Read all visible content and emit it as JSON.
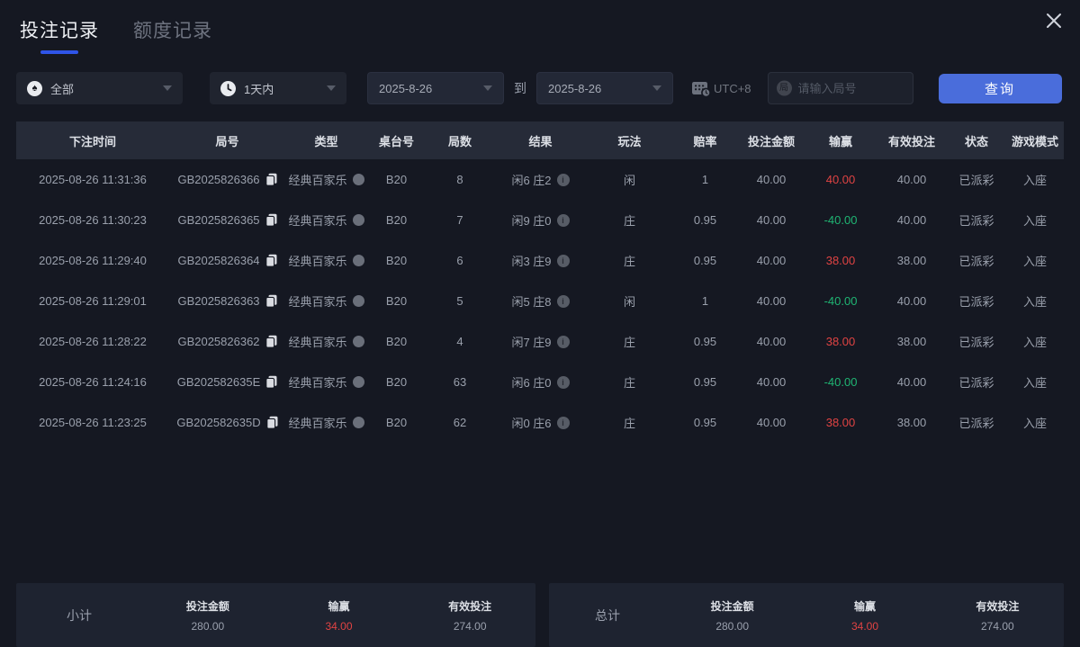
{
  "tabs": [
    {
      "label": "投注记录"
    },
    {
      "label": "额度记录"
    }
  ],
  "filters": {
    "game_type": {
      "value": "全部",
      "icon": "spade"
    },
    "time_range": {
      "value": "1天内",
      "icon": "clock"
    },
    "date_from": "2025-8-26",
    "to_label": "到",
    "date_to": "2025-8-26",
    "timezone": "UTC+8",
    "round_search": {
      "placeholder": "请输入局号",
      "icon_char": "局"
    },
    "query_label": "查询"
  },
  "table": {
    "columns": [
      "下注时间",
      "局号",
      "类型",
      "桌台号",
      "局数",
      "结果",
      "玩法",
      "赔率",
      "投注金额",
      "输赢",
      "有效投注",
      "状态",
      "游戏模式"
    ],
    "rows": [
      {
        "time": "2025-08-26 11:31:36",
        "round_id": "GB2025826366",
        "game": "经典百家乐",
        "table_no": "B20",
        "shoe": "8",
        "result": "闲6 庄2",
        "play": "闲",
        "odds": "1",
        "bet": "40.00",
        "win_loss": "40.00",
        "win_loss_type": "win",
        "valid_bet": "40.00",
        "status": "已派彩",
        "mode": "入座"
      },
      {
        "time": "2025-08-26 11:30:23",
        "round_id": "GB2025826365",
        "game": "经典百家乐",
        "table_no": "B20",
        "shoe": "7",
        "result": "闲9 庄0",
        "play": "庄",
        "odds": "0.95",
        "bet": "40.00",
        "win_loss": "-40.00",
        "win_loss_type": "loss",
        "valid_bet": "40.00",
        "status": "已派彩",
        "mode": "入座"
      },
      {
        "time": "2025-08-26 11:29:40",
        "round_id": "GB2025826364",
        "game": "经典百家乐",
        "table_no": "B20",
        "shoe": "6",
        "result": "闲3 庄9",
        "play": "庄",
        "odds": "0.95",
        "bet": "40.00",
        "win_loss": "38.00",
        "win_loss_type": "win",
        "valid_bet": "38.00",
        "status": "已派彩",
        "mode": "入座"
      },
      {
        "time": "2025-08-26 11:29:01",
        "round_id": "GB2025826363",
        "game": "经典百家乐",
        "table_no": "B20",
        "shoe": "5",
        "result": "闲5 庄8",
        "play": "闲",
        "odds": "1",
        "bet": "40.00",
        "win_loss": "-40.00",
        "win_loss_type": "loss",
        "valid_bet": "40.00",
        "status": "已派彩",
        "mode": "入座"
      },
      {
        "time": "2025-08-26 11:28:22",
        "round_id": "GB2025826362",
        "game": "经典百家乐",
        "table_no": "B20",
        "shoe": "4",
        "result": "闲7 庄9",
        "play": "庄",
        "odds": "0.95",
        "bet": "40.00",
        "win_loss": "38.00",
        "win_loss_type": "win",
        "valid_bet": "38.00",
        "status": "已派彩",
        "mode": "入座"
      },
      {
        "time": "2025-08-26 11:24:16",
        "round_id": "GB202582635E",
        "game": "经典百家乐",
        "table_no": "B20",
        "shoe": "63",
        "result": "闲6 庄0",
        "play": "庄",
        "odds": "0.95",
        "bet": "40.00",
        "win_loss": "-40.00",
        "win_loss_type": "loss",
        "valid_bet": "40.00",
        "status": "已派彩",
        "mode": "入座"
      },
      {
        "time": "2025-08-26 11:23:25",
        "round_id": "GB202582635D",
        "game": "经典百家乐",
        "table_no": "B20",
        "shoe": "62",
        "result": "闲0 庄6",
        "play": "庄",
        "odds": "0.95",
        "bet": "40.00",
        "win_loss": "38.00",
        "win_loss_type": "win",
        "valid_bet": "38.00",
        "status": "已派彩",
        "mode": "入座"
      }
    ]
  },
  "summary": {
    "subtotal": {
      "label": "小计",
      "stats": [
        {
          "label": "投注金额",
          "value": "280.00",
          "color": "normal"
        },
        {
          "label": "输赢",
          "value": "34.00",
          "color": "red"
        },
        {
          "label": "有效投注",
          "value": "274.00",
          "color": "normal"
        }
      ]
    },
    "total": {
      "label": "总计",
      "stats": [
        {
          "label": "投注金额",
          "value": "280.00",
          "color": "normal"
        },
        {
          "label": "输赢",
          "value": "34.00",
          "color": "red"
        },
        {
          "label": "有效投注",
          "value": "274.00",
          "color": "normal"
        }
      ]
    }
  },
  "colors": {
    "accent_blue": "#4a6ddb",
    "tab_underline": "#2f54e8",
    "win_red": "#e04343",
    "loss_green": "#1fb573"
  }
}
